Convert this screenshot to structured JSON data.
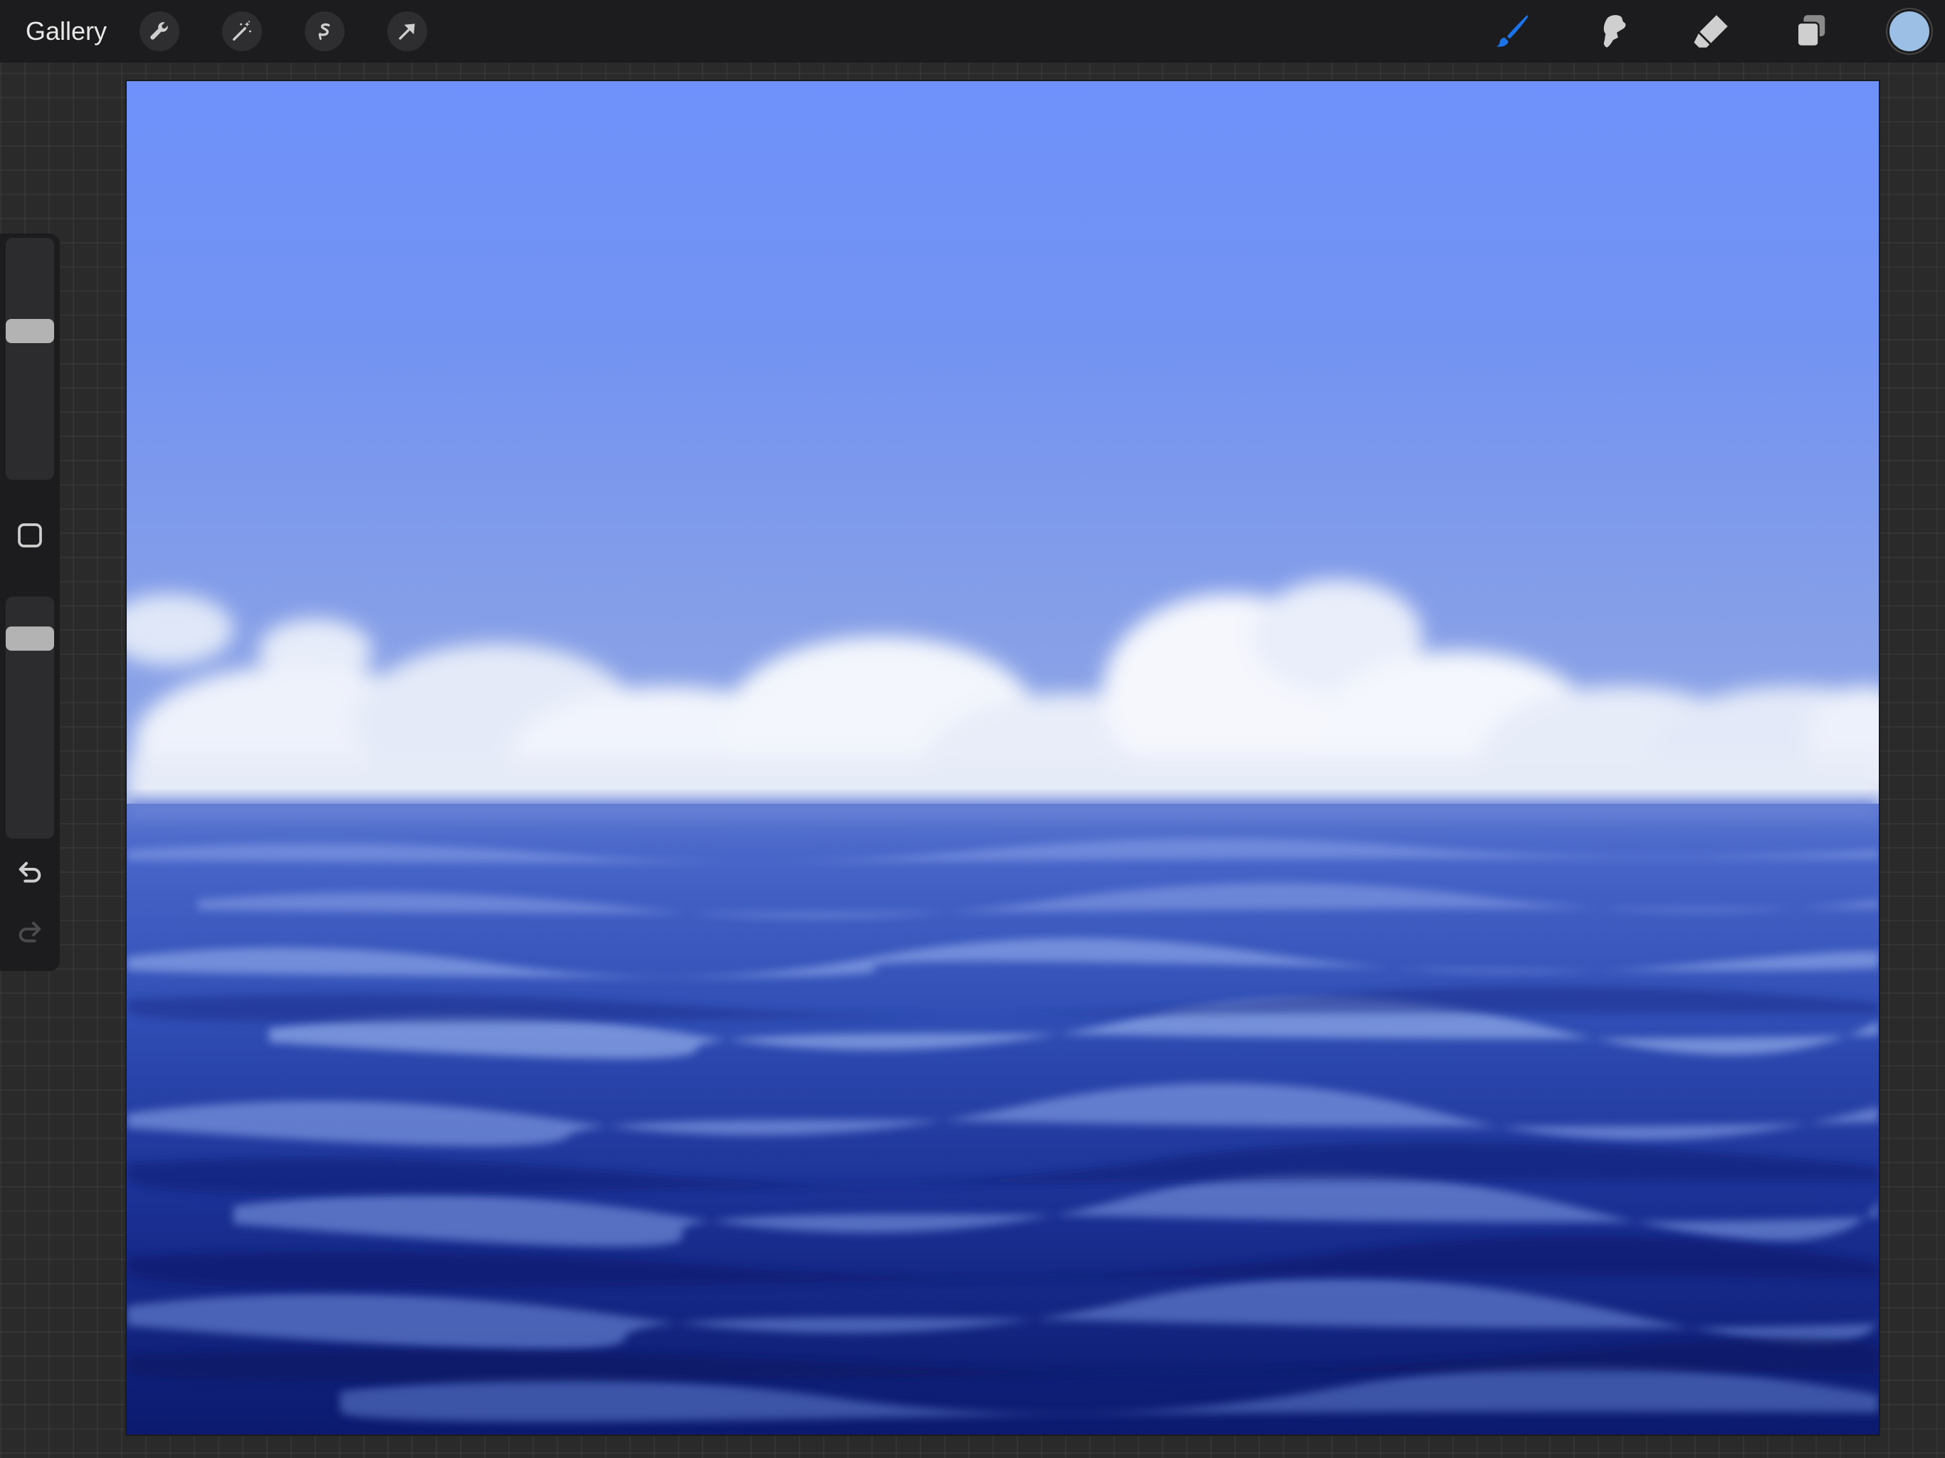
{
  "toolbar": {
    "gallery_label": "Gallery",
    "left_tools": [
      {
        "icon": "wrench-icon",
        "name": "actions"
      },
      {
        "icon": "magic-wand-icon",
        "name": "adjustments"
      },
      {
        "icon": "selection-s-icon",
        "name": "selection"
      },
      {
        "icon": "arrow-cursor-icon",
        "name": "transform"
      }
    ],
    "right_tools": [
      {
        "icon": "brush-icon",
        "name": "paint",
        "active": true,
        "color": "#1a73e8"
      },
      {
        "icon": "smudge-icon",
        "name": "smudge",
        "active": false
      },
      {
        "icon": "eraser-icon",
        "name": "erase",
        "active": false
      },
      {
        "icon": "layers-icon",
        "name": "layers",
        "active": false
      }
    ],
    "current_color": "#9cbfe6"
  },
  "sidebar": {
    "size_slider_icon": "brush-size-slider",
    "opacity_slider_icon": "brush-opacity-slider",
    "modify_icon": "square-modify-icon",
    "undo_icon": "undo-arrow-icon",
    "redo_icon": "redo-arrow-icon",
    "redo_enabled": false
  },
  "canvas": {
    "content": "ocean-painting",
    "colors": {
      "sky_top": "#6e91fb",
      "sky_horizon": "#8ea4e8",
      "cloud": "#f3f6fc",
      "sea_near_horizon": "#4866c9",
      "sea_deep": "#0b1a6e"
    }
  }
}
